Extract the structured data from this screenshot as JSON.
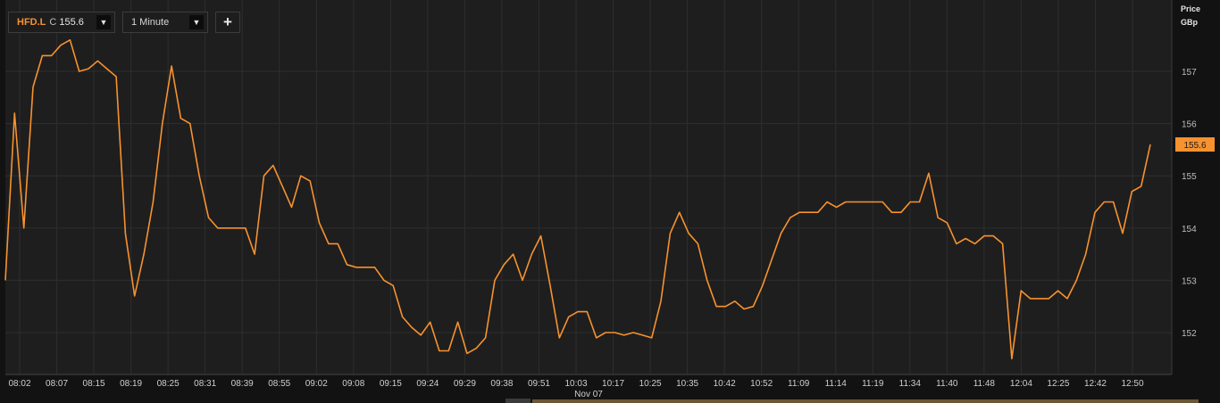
{
  "toolbar": {
    "symbol": "HFD.L",
    "close_label": "C",
    "close_value": "155.6",
    "interval": "1 Minute",
    "add_label": "+"
  },
  "axis": {
    "unit_top": "Price",
    "unit_bottom": "GBp",
    "date_label": "Nov 07"
  },
  "colors": {
    "line": "#f7922f",
    "background": "#121212",
    "grid": "#2c2c2c"
  },
  "chart_data": {
    "type": "line",
    "title": "",
    "ylabel": "Price GBp",
    "ylim": [
      151.2,
      158.3
    ],
    "grid": true,
    "y_ticks": [
      152,
      153,
      154,
      155,
      156,
      157
    ],
    "x_ticks": [
      "08:02",
      "08:07",
      "08:15",
      "08:19",
      "08:25",
      "08:31",
      "08:39",
      "08:55",
      "09:02",
      "09:08",
      "09:15",
      "09:24",
      "09:29",
      "09:38",
      "09:51",
      "10:03",
      "10:17",
      "10:25",
      "10:35",
      "10:42",
      "10:52",
      "11:09",
      "11:14",
      "11:19",
      "11:34",
      "11:40",
      "11:48",
      "12:04",
      "12:25",
      "12:42",
      "12:50"
    ],
    "last_value": 155.6,
    "series": [
      {
        "values": [
          153.0,
          156.2,
          154.0,
          156.7,
          157.3,
          157.3,
          157.5,
          157.6,
          157.0,
          157.05,
          157.2,
          157.05,
          156.9,
          153.9,
          152.7,
          153.5,
          154.5,
          156.0,
          157.1,
          156.1,
          156.0,
          155.0,
          154.2,
          154.0,
          154.0,
          154.0,
          154.0,
          153.5,
          155.0,
          155.2,
          154.8,
          154.4,
          155.0,
          154.9,
          154.1,
          153.7,
          153.7,
          153.3,
          153.25,
          153.25,
          153.25,
          153.0,
          152.9,
          152.3,
          152.1,
          151.95,
          152.2,
          151.65,
          151.65,
          152.2,
          151.6,
          151.7,
          151.9,
          153.0,
          153.3,
          153.5,
          153.0,
          153.5,
          153.85,
          152.9,
          151.9,
          152.3,
          152.4,
          152.4,
          151.9,
          152.0,
          152.0,
          151.95,
          152.0,
          151.95,
          151.9,
          152.6,
          153.9,
          154.3,
          153.9,
          153.7,
          153.0,
          152.5,
          152.5,
          152.6,
          152.45,
          152.5,
          152.9,
          153.4,
          153.9,
          154.2,
          154.3,
          154.3,
          154.3,
          154.5,
          154.4,
          154.5,
          154.5,
          154.5,
          154.5,
          154.5,
          154.3,
          154.3,
          154.5,
          154.5,
          155.05,
          154.2,
          154.1,
          153.7,
          153.8,
          153.7,
          153.85,
          153.85,
          153.7,
          151.5,
          152.8,
          152.65,
          152.65,
          152.65,
          152.8,
          152.65,
          153.0,
          153.5,
          154.3,
          154.5,
          154.5,
          153.9,
          154.7,
          154.8,
          155.6
        ]
      }
    ]
  }
}
